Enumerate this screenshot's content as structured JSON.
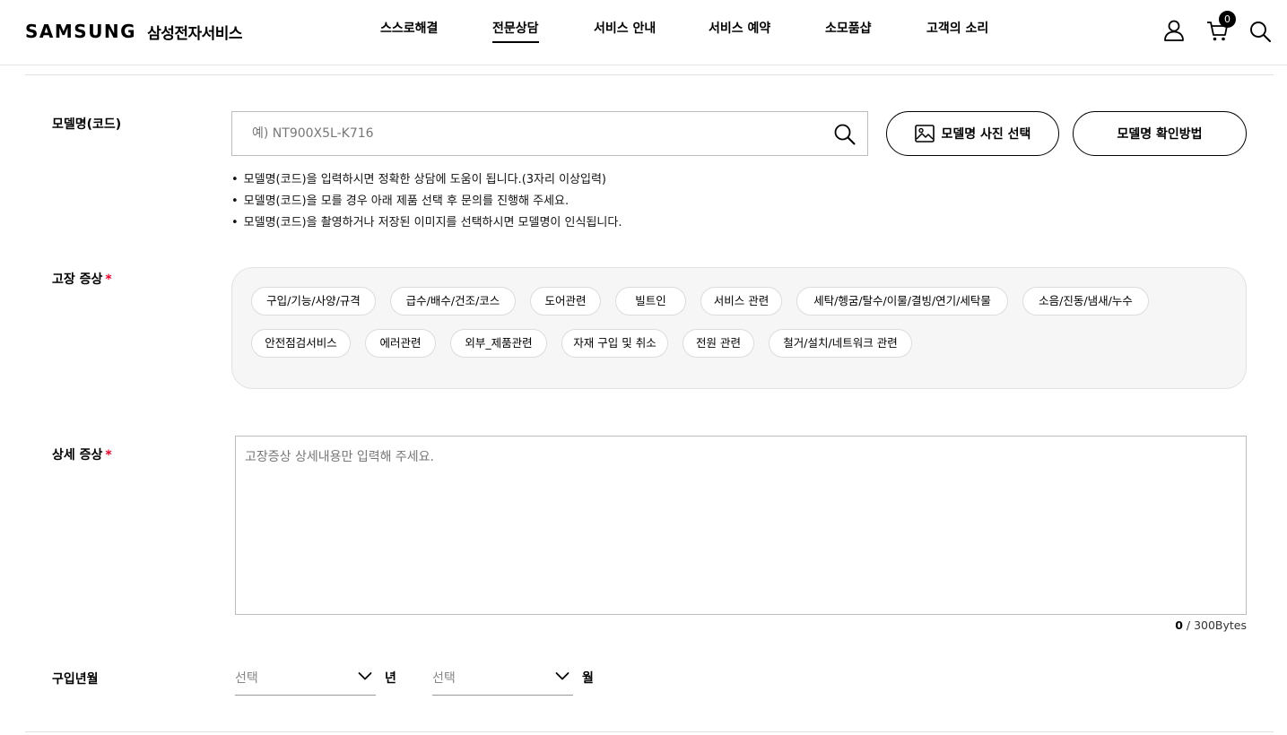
{
  "header": {
    "logo": "SAMSUNG",
    "logo_sub": "삼성전자서비스",
    "nav": [
      {
        "label": "스스로해결",
        "active": false
      },
      {
        "label": "전문상담",
        "active": true
      },
      {
        "label": "서비스 안내",
        "active": false
      },
      {
        "label": "서비스 예약",
        "active": false
      },
      {
        "label": "소모품샵",
        "active": false
      },
      {
        "label": "고객의 소리",
        "active": false
      }
    ],
    "icons": [
      "user-icon",
      "cart-icon",
      "search-icon"
    ],
    "cart_count": "0"
  },
  "model": {
    "label": "모델명(코드)",
    "placeholder": "예) NT900X5L-K716",
    "value": "",
    "photo_button": "모델명 사진 선택",
    "howto_button": "모델명 확인방법",
    "notes": [
      "모델명(코드)을 입력하시면 정확한 상담에 도움이 됩니다.(3자리 이상입력)",
      "모델명(코드)을 모를 경우 아래 제품 선택 후 문의를 진행해 주세요.",
      "모델명(코드)을 촬영하거나 저장된 이미지를 선택하시면 모델명이 인식됩니다."
    ]
  },
  "symptom": {
    "label": "고장 증상",
    "required_mark": "*",
    "chips": [
      "구입/기능/사양/규격",
      "급수/배수/건조/코스",
      "도어관련",
      "빌트인",
      "서비스 관련",
      "세탁/헹굼/탈수/이물/결빙/연기/세탁물",
      "소음/진동/냄새/누수",
      "안전점검서비스",
      "에러관련",
      "외부_제품관련",
      "자재 구입 및 취소",
      "전원 관련",
      "철거/설치/네트워크 관련"
    ]
  },
  "detail": {
    "label": "상세 증상",
    "required_mark": "*",
    "placeholder": "고장증상 상세내용만 입력해 주세요.",
    "value": "",
    "count": "0",
    "limit": " / 300Bytes"
  },
  "purchase": {
    "label": "구입년월",
    "year_select": "선택",
    "year_unit": "년",
    "month_select": "선택",
    "month_unit": "월"
  },
  "colors": {
    "accent": "#000000",
    "required": "#e4002b",
    "chip_area_bg": "#f6f6f6"
  }
}
